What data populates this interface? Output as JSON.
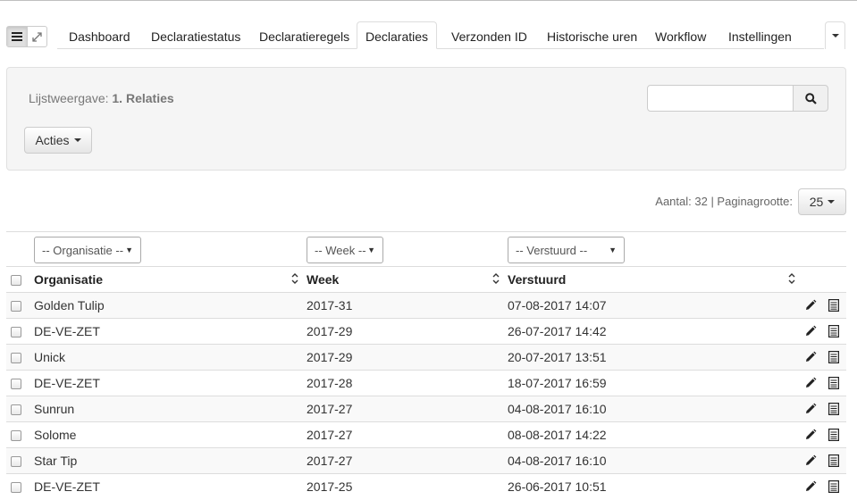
{
  "view_toggle": {
    "list_icon": "list-icon",
    "expand_icon": "expand-icon"
  },
  "tabs": [
    {
      "label": "Dashboard",
      "active": false
    },
    {
      "label": "Declaratiestatus",
      "active": false
    },
    {
      "label": "Declaratieregels",
      "active": false
    },
    {
      "label": "Declaraties",
      "active": true
    },
    {
      "label": "Verzonden ID",
      "active": false
    },
    {
      "label": "Historische uren",
      "active": false
    },
    {
      "label": "Workflow",
      "active": false
    },
    {
      "label": "Instellingen",
      "active": false
    }
  ],
  "panel": {
    "listview_prefix": "Lijstweergave:",
    "listview_value": "1. Relaties",
    "search_placeholder": "",
    "actions_label": "Acties"
  },
  "paging": {
    "count_text": "Aantal: 32 | Paginagrootte:",
    "page_size": "25"
  },
  "filters": {
    "organisatie": "-- Organisatie --",
    "week": "-- Week --",
    "verstuurd": "-- Verstuurd --"
  },
  "table": {
    "headers": {
      "organisatie": "Organisatie",
      "week": "Week",
      "verstuurd": "Verstuurd"
    },
    "rows": [
      {
        "organisatie": "Golden Tulip",
        "week": "2017-31",
        "verstuurd": "07-08-2017 14:07"
      },
      {
        "organisatie": "DE-VE-ZET",
        "week": "2017-29",
        "verstuurd": "26-07-2017 14:42"
      },
      {
        "organisatie": "Unick",
        "week": "2017-29",
        "verstuurd": "20-07-2017 13:51"
      },
      {
        "organisatie": "DE-VE-ZET",
        "week": "2017-28",
        "verstuurd": "18-07-2017 16:59"
      },
      {
        "organisatie": "Sunrun",
        "week": "2017-27",
        "verstuurd": "04-08-2017 16:10"
      },
      {
        "organisatie": "Solome",
        "week": "2017-27",
        "verstuurd": "08-08-2017 14:22"
      },
      {
        "organisatie": "Star Tip",
        "week": "2017-27",
        "verstuurd": "04-08-2017 16:10"
      },
      {
        "organisatie": "DE-VE-ZET",
        "week": "2017-25",
        "verstuurd": "26-06-2017 10:51"
      }
    ]
  },
  "colors": {
    "tab_border": "#dddddd",
    "well_bg": "#f5f5f5",
    "row_stripe": "#f9f9f9"
  }
}
